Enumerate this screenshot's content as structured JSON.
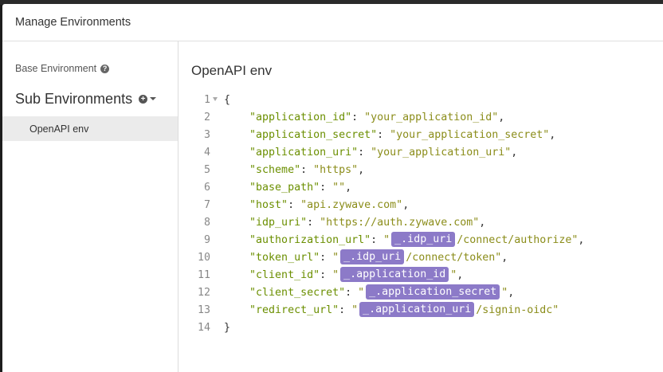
{
  "modal": {
    "title": "Manage Environments"
  },
  "sidebar": {
    "base_environment": "Base Environment",
    "sub_environments": "Sub Environments",
    "items": [
      {
        "label": "OpenAPI env"
      }
    ]
  },
  "main": {
    "env_name": "OpenAPI env"
  },
  "editor": {
    "lines": [
      {
        "n": "1",
        "parts": [
          {
            "t": "p",
            "v": "{"
          }
        ]
      },
      {
        "n": "2",
        "parts": [
          {
            "t": "p",
            "v": "    "
          },
          {
            "t": "k",
            "v": "\"application_id\""
          },
          {
            "t": "p",
            "v": ": "
          },
          {
            "t": "s",
            "v": "\"your_application_id\""
          },
          {
            "t": "p",
            "v": ","
          }
        ]
      },
      {
        "n": "3",
        "parts": [
          {
            "t": "p",
            "v": "    "
          },
          {
            "t": "k",
            "v": "\"application_secret\""
          },
          {
            "t": "p",
            "v": ": "
          },
          {
            "t": "s",
            "v": "\"your_application_secret\""
          },
          {
            "t": "p",
            "v": ","
          }
        ]
      },
      {
        "n": "4",
        "parts": [
          {
            "t": "p",
            "v": "    "
          },
          {
            "t": "k",
            "v": "\"application_uri\""
          },
          {
            "t": "p",
            "v": ": "
          },
          {
            "t": "s",
            "v": "\"your_application_uri\""
          },
          {
            "t": "p",
            "v": ","
          }
        ]
      },
      {
        "n": "5",
        "parts": [
          {
            "t": "p",
            "v": "    "
          },
          {
            "t": "k",
            "v": "\"scheme\""
          },
          {
            "t": "p",
            "v": ": "
          },
          {
            "t": "s",
            "v": "\"https\""
          },
          {
            "t": "p",
            "v": ","
          }
        ]
      },
      {
        "n": "6",
        "parts": [
          {
            "t": "p",
            "v": "    "
          },
          {
            "t": "k",
            "v": "\"base_path\""
          },
          {
            "t": "p",
            "v": ": "
          },
          {
            "t": "s",
            "v": "\"\""
          },
          {
            "t": "p",
            "v": ","
          }
        ]
      },
      {
        "n": "7",
        "parts": [
          {
            "t": "p",
            "v": "    "
          },
          {
            "t": "k",
            "v": "\"host\""
          },
          {
            "t": "p",
            "v": ": "
          },
          {
            "t": "s",
            "v": "\"api.zywave.com\""
          },
          {
            "t": "p",
            "v": ","
          }
        ]
      },
      {
        "n": "8",
        "parts": [
          {
            "t": "p",
            "v": "    "
          },
          {
            "t": "k",
            "v": "\"idp_uri\""
          },
          {
            "t": "p",
            "v": ": "
          },
          {
            "t": "s",
            "v": "\"https://auth.zywave.com\""
          },
          {
            "t": "p",
            "v": ","
          }
        ]
      },
      {
        "n": "9",
        "parts": [
          {
            "t": "p",
            "v": "    "
          },
          {
            "t": "k",
            "v": "\"authorization_url\""
          },
          {
            "t": "p",
            "v": ": "
          },
          {
            "t": "s",
            "v": "\""
          },
          {
            "t": "tag",
            "v": "_.idp_uri"
          },
          {
            "t": "s",
            "v": "/connect/authorize\""
          },
          {
            "t": "p",
            "v": ","
          }
        ]
      },
      {
        "n": "10",
        "parts": [
          {
            "t": "p",
            "v": "    "
          },
          {
            "t": "k",
            "v": "\"token_url\""
          },
          {
            "t": "p",
            "v": ": "
          },
          {
            "t": "s",
            "v": "\""
          },
          {
            "t": "tag",
            "v": "_.idp_uri"
          },
          {
            "t": "s",
            "v": "/connect/token\""
          },
          {
            "t": "p",
            "v": ","
          }
        ]
      },
      {
        "n": "11",
        "parts": [
          {
            "t": "p",
            "v": "    "
          },
          {
            "t": "k",
            "v": "\"client_id\""
          },
          {
            "t": "p",
            "v": ": "
          },
          {
            "t": "s",
            "v": "\""
          },
          {
            "t": "tag",
            "v": "_.application_id"
          },
          {
            "t": "s",
            "v": "\""
          },
          {
            "t": "p",
            "v": ","
          }
        ]
      },
      {
        "n": "12",
        "parts": [
          {
            "t": "p",
            "v": "    "
          },
          {
            "t": "k",
            "v": "\"client_secret\""
          },
          {
            "t": "p",
            "v": ": "
          },
          {
            "t": "s",
            "v": "\""
          },
          {
            "t": "tag",
            "v": "_.application_secret"
          },
          {
            "t": "s",
            "v": "\""
          },
          {
            "t": "p",
            "v": ","
          }
        ]
      },
      {
        "n": "13",
        "parts": [
          {
            "t": "p",
            "v": "    "
          },
          {
            "t": "k",
            "v": "\"redirect_url\""
          },
          {
            "t": "p",
            "v": ": "
          },
          {
            "t": "s",
            "v": "\""
          },
          {
            "t": "tag",
            "v": "_.application_uri"
          },
          {
            "t": "s",
            "v": "/signin-oidc\""
          }
        ]
      },
      {
        "n": "14",
        "parts": [
          {
            "t": "p",
            "v": "}"
          }
        ]
      }
    ]
  },
  "colors": {
    "tag_bg": "#8c7ac8",
    "key": "#6b8f00",
    "string": "#8b8d1a",
    "selected_bg": "#ebebeb"
  }
}
